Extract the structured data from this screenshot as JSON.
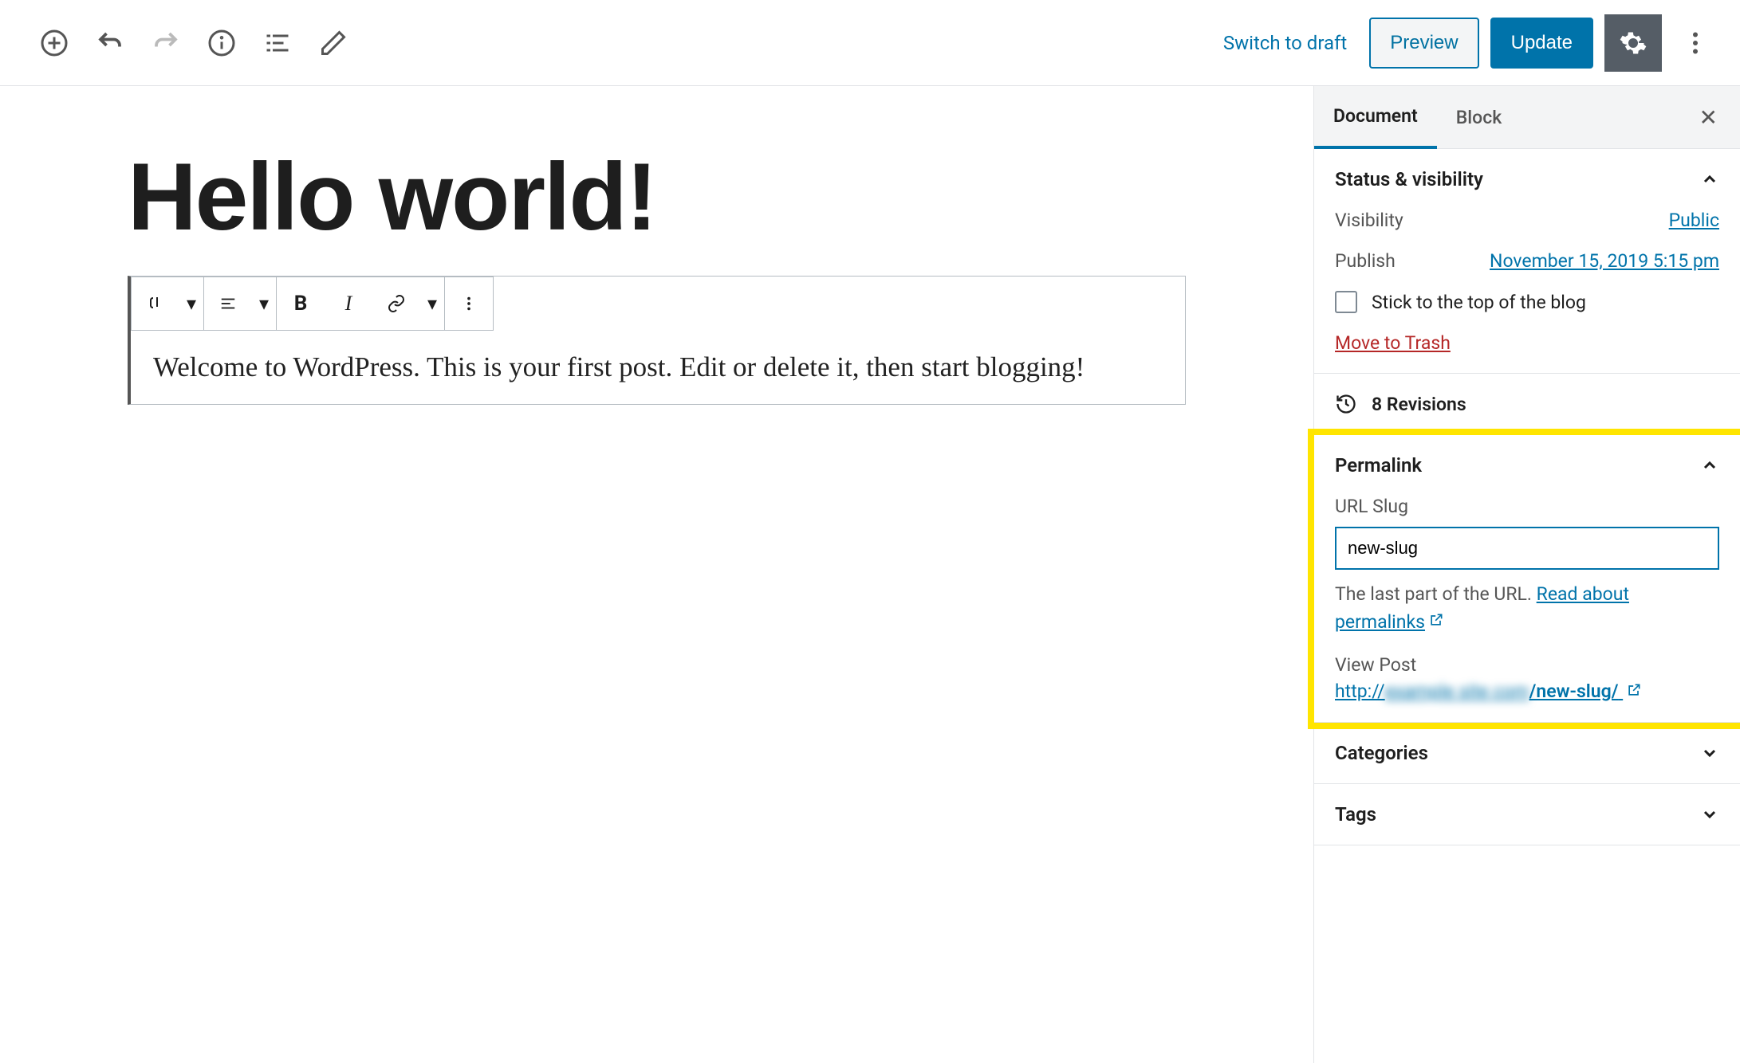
{
  "topbar": {
    "switch_draft": "Switch to draft",
    "preview": "Preview",
    "update": "Update"
  },
  "post": {
    "title": "Hello world!",
    "body": "Welcome to WordPress. This is your first post. Edit or delete it, then start blogging!"
  },
  "sidebar": {
    "tabs": {
      "document": "Document",
      "block": "Block"
    },
    "status": {
      "title": "Status & visibility",
      "visibility_label": "Visibility",
      "visibility_value": "Public",
      "publish_label": "Publish",
      "publish_value": "November 15, 2019 5:15 pm",
      "stick": "Stick to the top of the blog",
      "trash": "Move to Trash"
    },
    "revisions": {
      "count": "8 Revisions"
    },
    "permalink": {
      "title": "Permalink",
      "slug_label": "URL Slug",
      "slug_value": "new-slug",
      "help_prefix": "The last part of the URL. ",
      "help_link": "Read about permalinks",
      "view_label": "View Post",
      "url_prefix": "http://",
      "url_hidden": "example site com",
      "url_suffix": "/new-slug/"
    },
    "categories": {
      "title": "Categories"
    },
    "tags": {
      "title": "Tags"
    }
  }
}
